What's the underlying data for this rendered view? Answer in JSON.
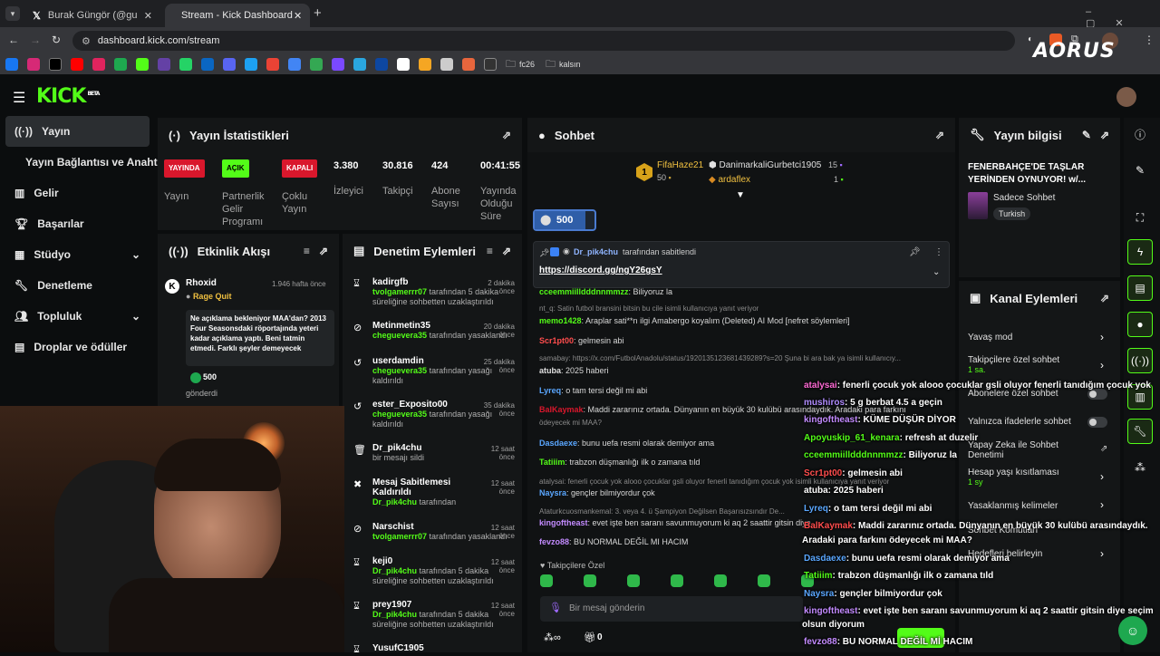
{
  "browser": {
    "tabs": [
      {
        "label": "Burak Güngör (@gungorburak)"
      },
      {
        "label": "Stream - Kick Dashboard"
      }
    ],
    "url": "dashboard.kick.com/stream",
    "bookmark_folders": [
      "fc26",
      "kalsın"
    ],
    "watermark": "AORUS"
  },
  "sidebar": {
    "items": [
      {
        "label": "Yayın"
      },
      {
        "label": "Yayın Bağlantısı ve Anahtarı"
      },
      {
        "label": "Gelir"
      },
      {
        "label": "Başarılar"
      },
      {
        "label": "Stüdyo"
      },
      {
        "label": "Denetleme"
      },
      {
        "label": "Topluluk"
      },
      {
        "label": "Droplar ve ödüller"
      }
    ]
  },
  "stats": {
    "title": "Yayın İstatistikleri",
    "cells": [
      {
        "badge": "YAYINDA",
        "label": "Yayın"
      },
      {
        "badge": "AÇIK",
        "label": "Partnerlik Gelir Programı"
      },
      {
        "badge": "KAPALI",
        "label": "Çoklu Yayın"
      },
      {
        "value": "3.380",
        "label": "İzleyici"
      },
      {
        "value": "30.816",
        "label": "Takipçi"
      },
      {
        "value": "424",
        "label": "Abone Sayısı"
      },
      {
        "value": "00:41:55",
        "label": "Yayında Olduğu Süre"
      }
    ]
  },
  "activity": {
    "title": "Etkinlik Akışı",
    "user": "Rhoxid",
    "time": "1.946 hafta önce",
    "event": "Rage Quit",
    "message": "Ne açıklama bekleniyor MAA'dan? 2013 Four Seasonsdaki röportajında yeteri kadar açıklama yaptı. Beni tatmin etmedi. Farklı şeyler demeyecek",
    "amount": "500",
    "footer": "gönderdi"
  },
  "modlog": {
    "title": "Denetim Eylemleri",
    "items": [
      {
        "user": "kadirgfb",
        "time": "2 dakika önce",
        "actor": "tvolgamerrr07",
        "text": "tarafından 5 dakika süreliğine sohbetten uzaklaştırıldı"
      },
      {
        "user": "Metinmetin35",
        "time": "20 dakika önce",
        "actor": "cheguevera35",
        "text": "tarafından yasaklandı"
      },
      {
        "user": "userdamdin",
        "time": "25 dakika önce",
        "actor": "cheguevera35",
        "text": "tarafından yasağı kaldırıldı"
      },
      {
        "user": "ester_Exposito00",
        "time": "35 dakika önce",
        "actor": "cheguevera35",
        "text": "tarafından yasağı kaldırıldı"
      },
      {
        "user": "Dr_pik4chu",
        "time": "12 saat önce",
        "actor": "",
        "text": "bir mesajı sildi"
      },
      {
        "user": "Mesaj Sabitlemesi Kaldırıldı",
        "time": "12 saat önce",
        "actor": "Dr_pik4chu",
        "text": "tarafından"
      },
      {
        "user": "Narschist",
        "time": "12 saat önce",
        "actor": "tvolgamerrr07",
        "text": "tarafından yasaklandı"
      },
      {
        "user": "keji0",
        "time": "12 saat önce",
        "actor": "Dr_pik4chu",
        "text": "tarafından 5 dakika süreliğine sohbetten uzaklaştırıldı"
      },
      {
        "user": "prey1907",
        "time": "12 saat önce",
        "actor": "Dr_pik4chu",
        "text": "tarafından 5 dakika süreliğine sohbetten uzaklaştırıldı"
      },
      {
        "user": "YusufC1905",
        "time": "",
        "actor": "",
        "text": ""
      }
    ]
  },
  "chat": {
    "title": "Sohbet",
    "gifter1": {
      "rank": "1",
      "name": "FifaHaze21",
      "count": "50"
    },
    "gifter2": {
      "name": "DanimarkaliGurbetci1905",
      "count": "15"
    },
    "gifter3": {
      "name": "ardaflex",
      "count": "1"
    },
    "goal": "500",
    "pinned_by": "Dr_pik4chu",
    "pinned_suffix": "tarafından sabitlendi",
    "pinned_link": "https://discord.gg/ngY26gsY",
    "messages": [
      {
        "user": "cceemmiilldddnnmmzz",
        "text": ": Biliyoruz la"
      },
      {
        "user": "",
        "text": "nt_q: Satin futbol bransini bitsin bu cile isimli kullanıcıya yanıt veriyor"
      },
      {
        "user": "memo1428",
        "text": ": Araplar sati**n ilgi Amabergo koyalım (Deleted) AI Mod [nefret söylemleri]"
      },
      {
        "user": "Scr1pt00",
        "text": ": gelmesin abi"
      },
      {
        "user": "",
        "text": "samabay: https://x.com/FutbolAnadolu/status/1920135123681439289?s=20 Şuna bi ara bak ya isimli kullanıcıy..."
      },
      {
        "user": "atuba",
        "text": ": 2025 haberi"
      },
      {
        "user": "Lyreq",
        "text": ": o tam tersi değil mi abi"
      },
      {
        "user": "BalKaymak",
        "text": ": Maddi zararınız ortada. Dünyanın en büyük 30 kulübü arasındaydık. Aradaki para farkını"
      },
      {
        "user": "",
        "text": "ödeyecek mi MAA?"
      },
      {
        "user": "Dasdaexe",
        "text": ": bunu uefa resmi olarak demiyor ama"
      },
      {
        "user": "Tatiiim",
        "text": ": trabzon düşmanlığı ilk o zamana tıld"
      },
      {
        "user": "",
        "text": "atalysai: fenerli çocuk yok alooo çocuklar gsli oluyor fenerli tanıdığım çocuk yok isimli kullanıcıya yanıt veriyor"
      },
      {
        "user": "Naysra",
        "text": ": gençler bilmiyordur çok"
      },
      {
        "user": "",
        "text": "Ataturkcuosmankemal: 3. veya 4. ü Şampiyon Değilsen Başarısızsındır De..."
      },
      {
        "user": "kingoftheast",
        "text": ": evet işte ben saranı savunmuyorum ki aq 2 saattir gitsin diye"
      },
      {
        "user": "fevzo88",
        "text": ": BU NORMAL DEĞİL MI HACIM"
      }
    ],
    "followers_only": "Takipçilere Özel",
    "input_placeholder": "Bir mesaj gönderin",
    "bottom_count": "0"
  },
  "streaminfo": {
    "title": "Yayın bilgisi",
    "stream_title": "FENERBAHÇE'DE TAŞLAR YERİNDEN OYNUYOR! w/...",
    "category": "Sadece Sohbet",
    "language": "Turkish"
  },
  "channel_actions": {
    "title": "Kanal Eylemleri",
    "items": [
      {
        "label": "Yavaş mod"
      },
      {
        "label": "Takipçilere özel sohbet",
        "sub": "1 sa."
      },
      {
        "label": "Abonelere özel sohbet"
      },
      {
        "label": "Yalnızca ifadelerle sohbet"
      },
      {
        "label": "Yapay Zeka ile Sohbet Denetimi"
      },
      {
        "label": "Hesap yaşı kısıtlaması",
        "sub": "1 sy"
      },
      {
        "label": "Yasaklanmış kelimeler"
      },
      {
        "label": "Sohbet Komutları"
      },
      {
        "label": "Hedefleri belirleyin"
      }
    ]
  },
  "overlay_chat": [
    {
      "user": "atalysai",
      "text": ": fenerli çocuk yok alooo çocuklar gsli oluyor fenerli tanıdığım çocuk yok",
      "color": "#ff6ad5"
    },
    {
      "user": "mushiros",
      "text": ": 5 g berbat 4.5 a geçin",
      "color": "#b08cff"
    },
    {
      "user": "kingoftheast",
      "text": ": KÜME DÜŞÜR DİYOR",
      "color": "#c38bff"
    },
    {
      "user": "Apoyuskip_61_kenara",
      "text": ": refresh at duzelir",
      "color": "#53fc18"
    },
    {
      "user": "cceemmiilldddnnmmzz",
      "text": ": Biliyoruz la",
      "color": "#53fc18"
    },
    {
      "user": "Scr1pt00",
      "text": ": gelmesin abi",
      "color": "#ff4d4d"
    },
    {
      "user": "atuba",
      "text": ": 2025 haberi",
      "color": "#ffffff"
    },
    {
      "user": "Lyreq",
      "text": ": o tam tersi değil mi abi",
      "color": "#5aa7ff"
    },
    {
      "user": "BalKaymak",
      "text": ": Maddi zararınız ortada. Dünyanın en büyük 30 kulübü arasındaydık.",
      "color": "#ff4d4d"
    },
    {
      "user": "",
      "text": "Aradaki para farkını ödeyecek mi MAA?",
      "color": "#ffffff"
    },
    {
      "user": "Dasdaexe",
      "text": ": bunu uefa resmi olarak demiyor ama",
      "color": "#5aa7ff"
    },
    {
      "user": "Tatiiim",
      "text": ": trabzon düşmanlığı ilk o zamana tıld",
      "color": "#53fc18"
    },
    {
      "user": "Naysra",
      "text": ": gençler bilmiyordur çok",
      "color": "#5aa7ff"
    },
    {
      "user": "kingoftheast",
      "text": ": evet işte ben saranı savunmuyorum ki aq 2 saattir gitsin diye seçim",
      "color": "#c38bff"
    },
    {
      "user": "",
      "text": "olsun diyorum",
      "color": "#ffffff"
    },
    {
      "user": "fevzo88",
      "text": ": BU NORMAL DEĞİL Mİ HACIM",
      "color": "#c38bff"
    }
  ],
  "colors": {
    "accent": "#53fc18",
    "panel": "#141617",
    "bg": "#0b0d0e"
  }
}
